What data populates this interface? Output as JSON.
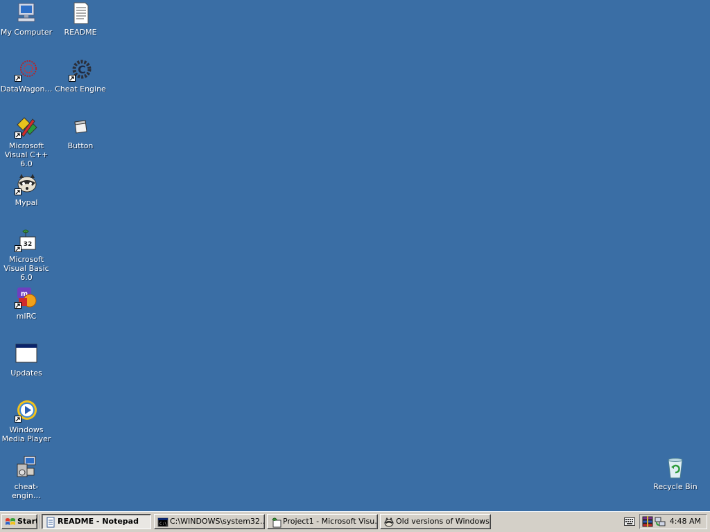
{
  "desktop": {
    "background_color": "#3a6ea5",
    "icons": {
      "my_computer": "My Computer",
      "readme": "README",
      "datawagon": "DataWagon…",
      "cheat_engine": "Cheat Engine",
      "msvc": "Microsoft Visual C++ 6.0",
      "button": "Button",
      "mypal": "Mypal",
      "msvb": "Microsoft Visual Basic 6.0",
      "mirc": "mIRC",
      "updates": "Updates",
      "wmp": "Windows Media Player",
      "cheat_engine_setup": "cheat-engin…",
      "recycle_bin": "Recycle Bin"
    }
  },
  "taskbar": {
    "start_label": "Start",
    "buttons": [
      "README - Notepad",
      "C:\\WINDOWS\\system32…",
      "Project1 - Microsoft Visu…",
      "Old versions of Windows…"
    ],
    "clock": "4:48 AM"
  }
}
